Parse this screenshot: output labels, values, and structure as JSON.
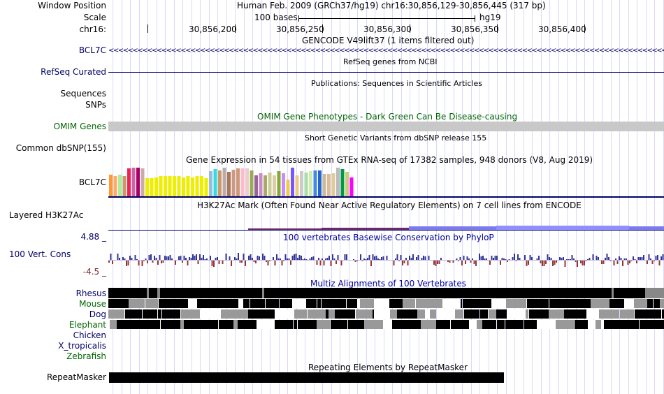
{
  "header": {
    "window_position_label": "Window Position",
    "scale_label": "Scale",
    "chrom_label": "chr16:",
    "position_text": "Human Feb. 2009 (GRCh37/hg19)   chr16:30,856,129-30,856,445 (317 bp)",
    "scale_text": "100 bases",
    "scale_assembly": "hg19",
    "ticks": [
      "30,856,200",
      "30,856,250",
      "30,856,300",
      "30,856,350",
      "30,856,400"
    ]
  },
  "tracks": {
    "gencode": {
      "title": "GENCODE V49lift37 (1 items filtered out)",
      "item": "BCL7C",
      "strand_glyphs": "<<<<<<<<<<<<<<<<<<<<<<<<<<<<<<<<<<<<<<<<<<<<<<<<<<<<<<<<<<<<<<<<<<<<<<<<<<<<<<<<<<<<<<<<<<<<<<<<<<<<<<<<<<<<<<<<<<<<<<<<<<<<<<<<<<<<<<<<<<<<<<<<<<<"
    },
    "refseq": {
      "title": "RefSeq genes from NCBI",
      "label": "RefSeq Curated"
    },
    "publications": {
      "title": "Publications: Sequences in Scientific Articles",
      "label_sequences": "Sequences",
      "label_snps": "SNPs"
    },
    "omim": {
      "title": "OMIM Gene Phenotypes - Dark Green Can Be Disease-causing",
      "label": "OMIM Genes",
      "bar_color": "#c8c8c8"
    },
    "dbsnp": {
      "title": "Short Genetic Variants from dbSNP release 155",
      "label": "Common dbSNP(155)"
    },
    "gtex": {
      "title": "Gene Expression in 54 tissues from GTEx RNA-seq of 17382 samples, 948 donors (V8, Aug 2019)",
      "label": "BCL7C",
      "bar_colors": [
        "#ff9933",
        "#ffaa66",
        "#aaee99",
        "#cc9966",
        "#ee2255",
        "#cc66aa",
        "#aa0066",
        "#ccaaaa",
        "#eeee00",
        "#eeee00",
        "#eeee00",
        "#eeee00",
        "#eeee00",
        "#eeee00",
        "#eeee00",
        "#eeee00",
        "#eeee00",
        "#eeee00",
        "#eeee00",
        "#eeee00",
        "#eeee00",
        "#eeee00",
        "#99bbdd",
        "#33dddd",
        "#cc9966",
        "#bbaaaa",
        "#aa7755",
        "#cc9988",
        "#cc9977",
        "#ffbbcc",
        "#eecccc",
        "#99aa55",
        "#996699",
        "#cc88cc",
        "#aaaa66",
        "#cccc99",
        "#ddccaa",
        "#88aa33",
        "#cc88ff",
        "#eecc44",
        "#7755ff",
        "#eecc88",
        "#cccccc",
        "#aaddaa",
        "#cceeaa",
        "#4488ee",
        "#2266cc",
        "#ccbb99",
        "#ddbb99",
        "#ddcc99",
        "#bbbbbb",
        "#009944",
        "#cccc77",
        "#ff00ff"
      ],
      "bar_values": [
        0.68,
        0.64,
        0.68,
        0.62,
        0.88,
        0.9,
        0.9,
        0.86,
        0.57,
        0.57,
        0.59,
        0.62,
        0.62,
        0.64,
        0.62,
        0.62,
        0.59,
        0.62,
        0.59,
        0.62,
        0.64,
        0.57,
        0.79,
        0.84,
        0.81,
        0.9,
        0.77,
        0.83,
        0.86,
        0.86,
        0.86,
        0.81,
        0.66,
        0.71,
        0.66,
        0.73,
        0.66,
        0.79,
        0.71,
        0.52,
        0.9,
        0.66,
        0.79,
        0.73,
        0.79,
        0.81,
        0.81,
        0.7,
        0.7,
        0.72,
        0.9,
        0.85,
        0.75,
        0.59
      ],
      "baseline_color": "#000066"
    },
    "h3k27ac": {
      "title": "H3K27Ac Mark (Often Found Near Active Regulatory Elements) on 7 cell lines from ENCODE",
      "label": "Layered H3K27Ac"
    },
    "phylop": {
      "title": "100 vertebrates Basewise Conservation by PhyloP",
      "label": "100 Vert. Cons",
      "max_label": "4.88 _",
      "min_label": "-4.5 _",
      "pos_color": "#333399",
      "neg_color": "#993333"
    },
    "multiz": {
      "title": "Multiz Alignments of 100 Vertebrates",
      "species": [
        {
          "name": "Rhesus",
          "color": "navy"
        },
        {
          "name": "Mouse",
          "color": "green"
        },
        {
          "name": "Dog",
          "color": "navy"
        },
        {
          "name": "Elephant",
          "color": "green"
        },
        {
          "name": "Chicken",
          "color": "navy"
        },
        {
          "name": "X_tropicalis",
          "color": "navy"
        },
        {
          "name": "Zebrafish",
          "color": "green"
        }
      ]
    },
    "repeatmasker": {
      "title": "Repeating Elements by RepeatMasker",
      "label": "RepeatMasker"
    }
  }
}
